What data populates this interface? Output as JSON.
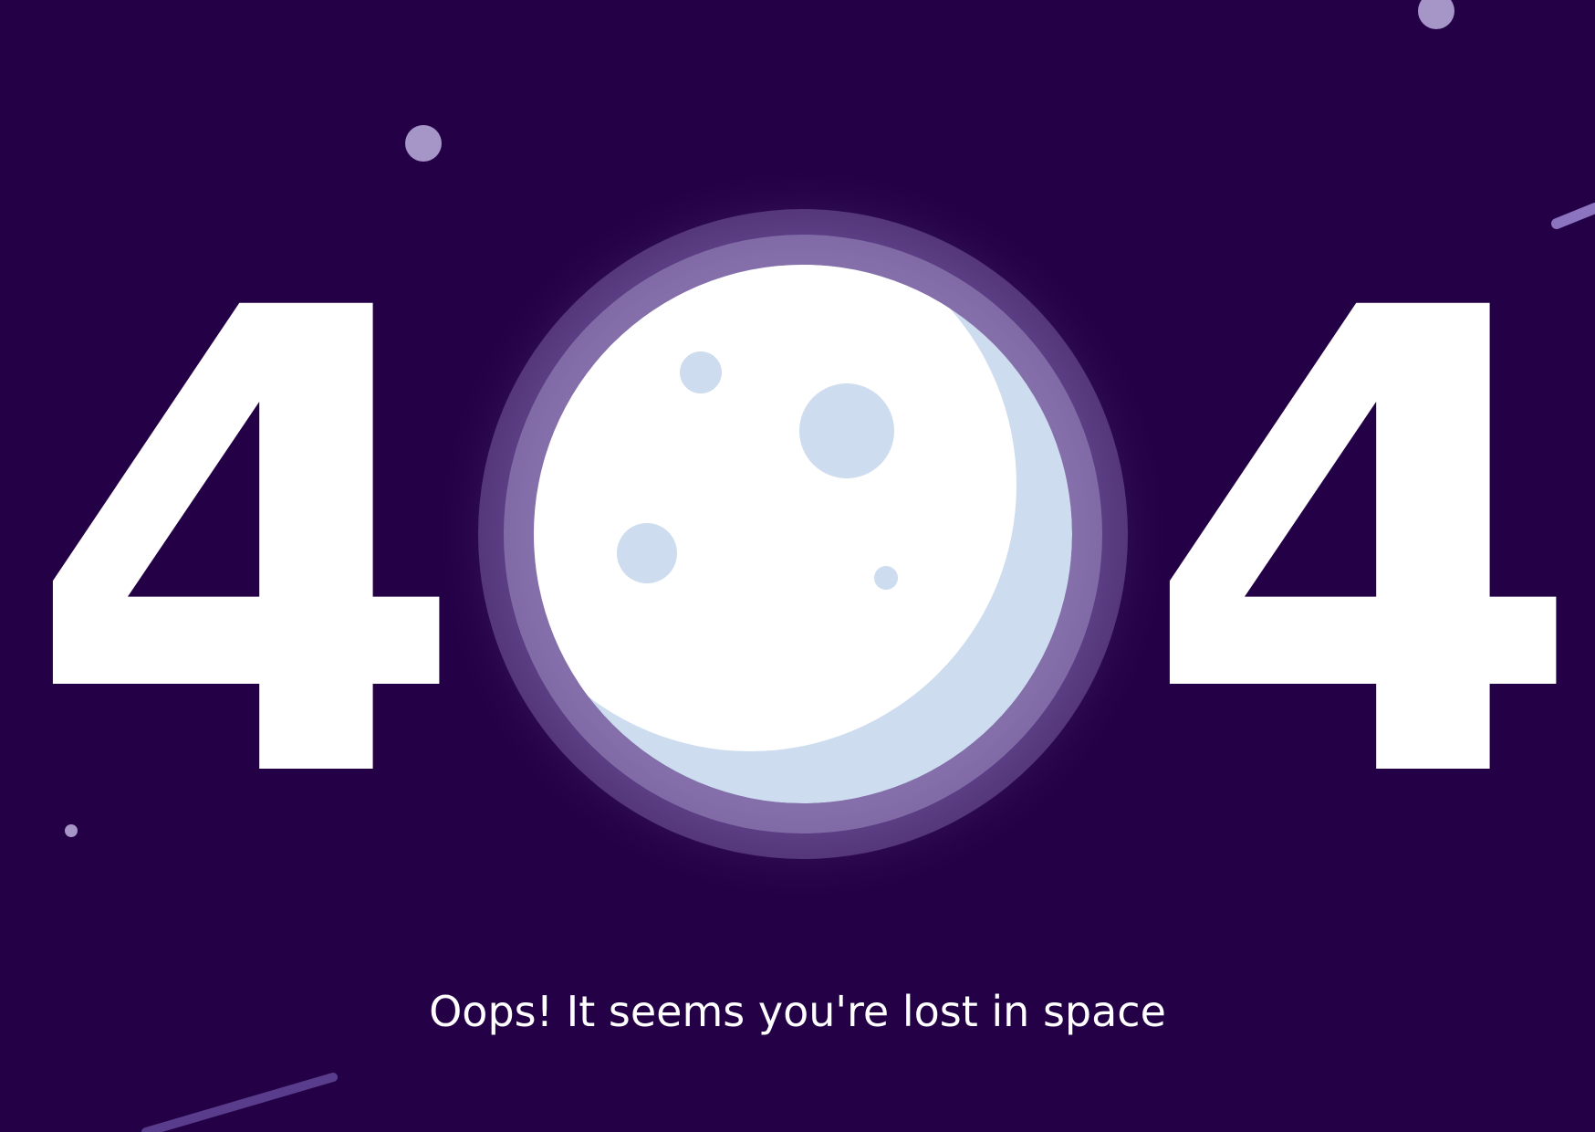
{
  "error_code": {
    "first_digit": "4",
    "last_digit": "4"
  },
  "message": "Oops! It seems you're lost in space",
  "colors": {
    "background": "#240046",
    "digit": "#ffffff",
    "moon_face": "#ffffff",
    "moon_shadow": "#cddcee",
    "crater": "#cddcee",
    "glow": "#8e78bb",
    "star": "#a695c7"
  },
  "icons": {
    "moon": "moon-icon",
    "stars": "star-icon",
    "shooting_stars": "shooting-star-icon"
  }
}
